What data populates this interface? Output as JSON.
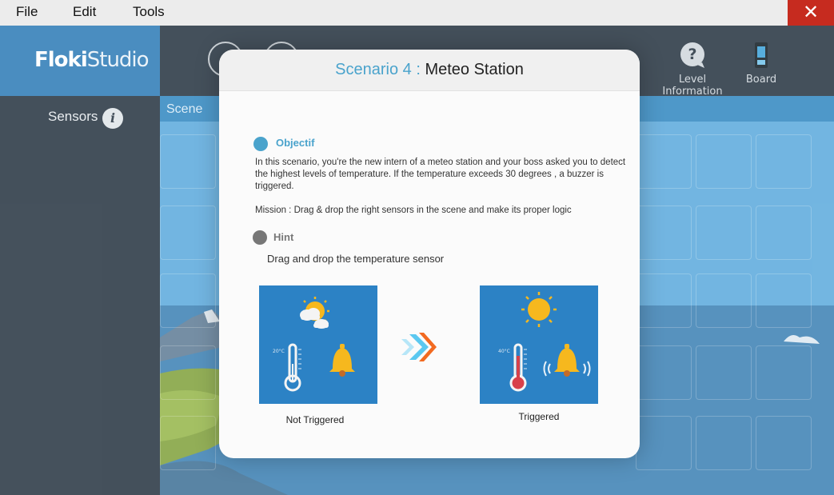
{
  "menu": {
    "file": "File",
    "edit": "Edit",
    "tools": "Tools",
    "close": "✕"
  },
  "logo": {
    "bold": "Floki",
    "light": "Studio"
  },
  "toolbar": {
    "level_information": "Level Information",
    "board": "Board"
  },
  "sidebar": {
    "sensors_label": "Sensors",
    "info_glyph": "i"
  },
  "scene": {
    "tab_label": "Scene"
  },
  "modal": {
    "title_prefix": "Scenario 4 :",
    "title_main": "Meteo Station",
    "objectif": {
      "title": "Objectif",
      "text1": "In this scenario, you're the new intern of a meteo station and your boss asked you to detect the highest levels of temperature.  If the temperature exceeds 30 degrees , a buzzer is triggered.",
      "text2": "Mission : Drag & drop the right sensors in the scene and make its proper logic"
    },
    "hint": {
      "title": "Hint",
      "text": "Drag and drop the temperature sensor"
    },
    "left_panel": {
      "temp": "20°C",
      "caption": "Not Triggered"
    },
    "right_panel": {
      "temp": "40°C",
      "caption": "Triggered"
    }
  },
  "colors": {
    "accent": "#4aa3cc",
    "panel_blue": "#2c82c5",
    "arrow_blue": "#5bc8f0",
    "arrow_orange": "#f26a21",
    "bell_yellow": "#f6b81e",
    "thermo_red": "#d8404a"
  },
  "icons": [
    "close-icon",
    "info-icon",
    "question-icon",
    "board-icon",
    "sun-icon",
    "cloud-sun-icon",
    "thermometer-icon",
    "bell-icon",
    "arrow-icon"
  ]
}
